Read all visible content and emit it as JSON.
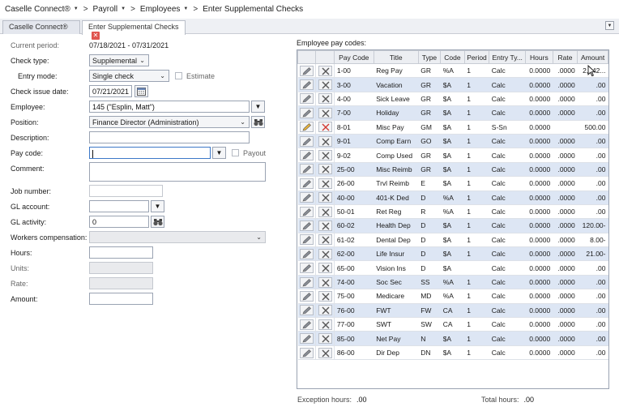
{
  "breadcrumb": {
    "items": [
      "Caselle Connect®",
      "Payroll",
      "Employees",
      "Enter Supplemental Checks"
    ]
  },
  "tabs": [
    {
      "label": "Caselle Connect®",
      "active": false,
      "closable": false
    },
    {
      "label": "Enter Supplemental Checks",
      "active": true,
      "closable": true
    }
  ],
  "form": {
    "current_period_label": "Current period:",
    "current_period_value": "07/18/2021 - 07/31/2021",
    "check_type_label": "Check type:",
    "check_type_value": "Supplemental",
    "entry_mode_label": "Entry mode:",
    "entry_mode_value": "Single check",
    "estimate_label": "Estimate",
    "check_issue_date_label": "Check issue date:",
    "check_issue_date_value": "07/21/2021",
    "employee_label": "Employee:",
    "employee_value": "145 (\"Esplin, Matt\")",
    "position_label": "Position:",
    "position_value": "Finance Director (Administration)",
    "description_label": "Description:",
    "description_value": "",
    "pay_code_label": "Pay code:",
    "pay_code_value": "",
    "payout_label": "Payout",
    "comment_label": "Comment:",
    "comment_value": "",
    "job_number_label": "Job number:",
    "job_number_value": "",
    "gl_account_label": "GL account:",
    "gl_account_value": "",
    "gl_activity_label": "GL activity:",
    "gl_activity_value": "0",
    "workers_comp_label": "Workers compensation:",
    "workers_comp_value": "",
    "hours_label": "Hours:",
    "hours_value": "",
    "units_label": "Units:",
    "units_value": "",
    "rate_label": "Rate:",
    "rate_value": "",
    "amount_label": "Amount:",
    "amount_value": ""
  },
  "pay_codes": {
    "title": "Employee pay codes:",
    "columns": [
      "Pay Code",
      "Title",
      "Type",
      "Code",
      "Period",
      "Entry Ty...",
      "Hours",
      "Rate",
      "Amount"
    ],
    "rows": [
      {
        "pay_code": "1-00",
        "title": "Reg Pay",
        "type": "GR",
        "code": "%A",
        "period": "1",
        "entry": "Calc",
        "hours": "0.0000",
        "rate": ".0000",
        "amount": "2,942..."
      },
      {
        "pay_code": "3-00",
        "title": "Vacation",
        "type": "GR",
        "code": "$A",
        "period": "1",
        "entry": "Calc",
        "hours": "0.0000",
        "rate": ".0000",
        "amount": ".00"
      },
      {
        "pay_code": "4-00",
        "title": "Sick Leave",
        "type": "GR",
        "code": "$A",
        "period": "1",
        "entry": "Calc",
        "hours": "0.0000",
        "rate": ".0000",
        "amount": ".00"
      },
      {
        "pay_code": "7-00",
        "title": "Holiday",
        "type": "GR",
        "code": "$A",
        "period": "1",
        "entry": "Calc",
        "hours": "0.0000",
        "rate": ".0000",
        "amount": ".00"
      },
      {
        "pay_code": "8-01",
        "title": "Misc Pay",
        "type": "GM",
        "code": "$A",
        "period": "1",
        "entry": "S-Sn",
        "hours": "0.0000",
        "rate": "",
        "amount": "500.00"
      },
      {
        "pay_code": "9-01",
        "title": "Comp Earn",
        "type": "GO",
        "code": "$A",
        "period": "1",
        "entry": "Calc",
        "hours": "0.0000",
        "rate": ".0000",
        "amount": ".00"
      },
      {
        "pay_code": "9-02",
        "title": "Comp Used",
        "type": "GR",
        "code": "$A",
        "period": "1",
        "entry": "Calc",
        "hours": "0.0000",
        "rate": ".0000",
        "amount": ".00"
      },
      {
        "pay_code": "25-00",
        "title": "Misc Reimb",
        "type": "GR",
        "code": "$A",
        "period": "1",
        "entry": "Calc",
        "hours": "0.0000",
        "rate": ".0000",
        "amount": ".00"
      },
      {
        "pay_code": "26-00",
        "title": "Trvl Reimb",
        "type": "E",
        "code": "$A",
        "period": "1",
        "entry": "Calc",
        "hours": "0.0000",
        "rate": ".0000",
        "amount": ".00"
      },
      {
        "pay_code": "40-00",
        "title": "401-K Ded",
        "type": "D",
        "code": "%A",
        "period": "1",
        "entry": "Calc",
        "hours": "0.0000",
        "rate": ".0000",
        "amount": ".00"
      },
      {
        "pay_code": "50-01",
        "title": "Ret Reg",
        "type": "R",
        "code": "%A",
        "period": "1",
        "entry": "Calc",
        "hours": "0.0000",
        "rate": ".0000",
        "amount": ".00"
      },
      {
        "pay_code": "60-02",
        "title": "Health Dep",
        "type": "D",
        "code": "$A",
        "period": "1",
        "entry": "Calc",
        "hours": "0.0000",
        "rate": ".0000",
        "amount": "120.00-"
      },
      {
        "pay_code": "61-02",
        "title": "Dental Dep",
        "type": "D",
        "code": "$A",
        "period": "1",
        "entry": "Calc",
        "hours": "0.0000",
        "rate": ".0000",
        "amount": "8.00-"
      },
      {
        "pay_code": "62-00",
        "title": "Life Insur",
        "type": "D",
        "code": "$A",
        "period": "1",
        "entry": "Calc",
        "hours": "0.0000",
        "rate": ".0000",
        "amount": "21.00-"
      },
      {
        "pay_code": "65-00",
        "title": "Vision Ins",
        "type": "D",
        "code": "$A",
        "period": "",
        "entry": "Calc",
        "hours": "0.0000",
        "rate": ".0000",
        "amount": ".00"
      },
      {
        "pay_code": "74-00",
        "title": "Soc Sec",
        "type": "SS",
        "code": "%A",
        "period": "1",
        "entry": "Calc",
        "hours": "0.0000",
        "rate": ".0000",
        "amount": ".00"
      },
      {
        "pay_code": "75-00",
        "title": "Medicare",
        "type": "MD",
        "code": "%A",
        "period": "1",
        "entry": "Calc",
        "hours": "0.0000",
        "rate": ".0000",
        "amount": ".00"
      },
      {
        "pay_code": "76-00",
        "title": "FWT",
        "type": "FW",
        "code": "CA",
        "period": "1",
        "entry": "Calc",
        "hours": "0.0000",
        "rate": ".0000",
        "amount": ".00"
      },
      {
        "pay_code": "77-00",
        "title": "SWT",
        "type": "SW",
        "code": "CA",
        "period": "1",
        "entry": "Calc",
        "hours": "0.0000",
        "rate": ".0000",
        "amount": ".00"
      },
      {
        "pay_code": "85-00",
        "title": "Net Pay",
        "type": "N",
        "code": "$A",
        "period": "1",
        "entry": "Calc",
        "hours": "0.0000",
        "rate": ".0000",
        "amount": ".00"
      },
      {
        "pay_code": "86-00",
        "title": "Dir Dep",
        "type": "DN",
        "code": "$A",
        "period": "1",
        "entry": "Calc",
        "hours": "0.0000",
        "rate": ".0000",
        "amount": ".00"
      }
    ],
    "highlighted_row_index": 4
  },
  "footer": {
    "exception_hours_label": "Exception hours:",
    "exception_hours_value": ".00",
    "total_hours_label": "Total hours:",
    "total_hours_value": ".00"
  },
  "colors": {
    "row_alt": "#dde6f4",
    "accent_focus": "#3c78c8",
    "delete_red": "#d23a32",
    "edit_yellow": "#e8b23a"
  }
}
